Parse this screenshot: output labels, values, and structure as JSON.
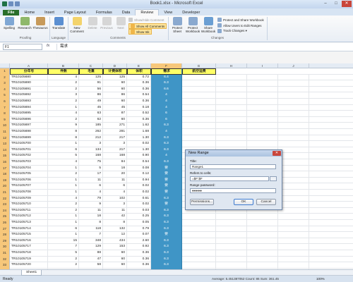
{
  "window": {
    "title": "Book1.xlsx - Microsoft Excel",
    "controls": [
      "–",
      "□",
      "✕"
    ]
  },
  "ribbon": {
    "tabs": [
      "File",
      "Home",
      "Insert",
      "Page Layout",
      "Formulas",
      "Data",
      "Review",
      "View",
      "Developer"
    ],
    "active_tab": "Review",
    "buttons": {
      "spelling": "Spelling",
      "research": "Research",
      "thesaurus": "Thesaurus",
      "translate": "Translate",
      "new_comment": "New Comment",
      "delete": "Delete",
      "previous": "Previous",
      "next": "Next",
      "show_hide_comment": "Show/Hide Comment",
      "show_all_comments": "Show All Comments",
      "show_ink": "Show Ink",
      "protect_sheet": "Protect Sheet",
      "protect_workbook": "Protect Workbook",
      "share_workbook": "Share Workbook",
      "protect_and_share": "Protect and Share Workbook",
      "allow_users": "Allow Users to Edit Ranges",
      "track_changes": "Track Changes ▾"
    },
    "groups": [
      "Proofing",
      "Language",
      "Comments",
      "Changes"
    ]
  },
  "formula_bar": {
    "name_box": "F1",
    "fx": "fx",
    "content": "需求"
  },
  "sheet": {
    "columns": [
      "A",
      "B",
      "C",
      "D",
      "E",
      "F",
      "G",
      "H",
      "I",
      "J"
    ],
    "selected_column": "F",
    "header_row": [
      "分年号",
      "件数",
      "毛重",
      "计费体积",
      "体积",
      "需求",
      "航空运费"
    ],
    "rows": [
      [
        "TR10105680",
        "4",
        "125",
        "125",
        "0.72",
        "6.4"
      ],
      [
        "TR10105690",
        "2",
        "91",
        "60",
        "0.36",
        "6.3"
      ],
      [
        "TR10105691",
        "2",
        "56",
        "60",
        "0.36",
        "6.6"
      ],
      [
        "TR10105692",
        "3",
        "86",
        "86",
        "0.54",
        "4"
      ],
      [
        "TR10105693",
        "2",
        "49",
        "60",
        "0.36",
        "4"
      ],
      [
        "TR10105694",
        "1",
        "45",
        "45",
        "0.18",
        "4"
      ],
      [
        "TR10105695",
        "4",
        "63",
        "87",
        "0.52",
        "6"
      ],
      [
        "TR10105696",
        "2",
        "62",
        "60",
        "0.36",
        "6"
      ],
      [
        "TR10105697",
        "9",
        "185",
        "271",
        "1.62",
        "6.3"
      ],
      [
        "TR10105698",
        "8",
        "262",
        "281",
        "1.68",
        "4"
      ],
      [
        "TR10105699",
        "8",
        "212",
        "217",
        "1.30",
        "6.3"
      ],
      [
        "TR10105700",
        "1",
        "3",
        "3",
        "0.02",
        "6.3"
      ],
      [
        "TR10105701",
        "6",
        "134",
        "217",
        "1.30",
        "6.3"
      ],
      [
        "TR10105702",
        "5",
        "168",
        "168",
        "0.90",
        "4"
      ],
      [
        "TR10105703",
        "4",
        "75",
        "84",
        "0.54",
        "6.3"
      ],
      [
        "TR10105704",
        "1",
        "5",
        "18",
        "0.08",
        "要"
      ],
      [
        "TR10105705",
        "2",
        "17",
        "20",
        "0.12",
        "要"
      ],
      [
        "TR10105706",
        "1",
        "11",
        "11",
        "0.94",
        "要"
      ],
      [
        "TR10105707",
        "1",
        "6",
        "6",
        "0.02",
        "要"
      ],
      [
        "TR10105708",
        "1",
        "4",
        "4",
        "0.02",
        "要"
      ],
      [
        "TR10105709",
        "4",
        "79",
        "102",
        "0.61",
        "6.3"
      ],
      [
        "TR10105710",
        "2",
        "9",
        "3",
        "0.02",
        "要"
      ],
      [
        "TR10105711",
        "2",
        "11",
        "11",
        "0.03",
        "6.3"
      ],
      [
        "TR10105712",
        "1",
        "18",
        "42",
        "0.25",
        "6.3"
      ],
      [
        "TR10105713",
        "1",
        "8",
        "8",
        "0.05",
        "6.3"
      ],
      [
        "TR10105714",
        "6",
        "118",
        "132",
        "0.79",
        "6.3"
      ],
      [
        "TR10105715",
        "1",
        "7",
        "12",
        "0.07",
        "要"
      ],
      [
        "TR10105716",
        "15",
        "348",
        "434",
        "2.60",
        "6.3"
      ],
      [
        "TR10105717",
        "7",
        "129",
        "153",
        "0.92",
        "6.3"
      ],
      [
        "TR10105718",
        "5",
        "88",
        "60",
        "0.36",
        "6.3"
      ],
      [
        "TR10105719",
        "2",
        "47",
        "60",
        "0.36",
        "6.3"
      ],
      [
        "TR10105720",
        "2",
        "58",
        "60",
        "0.36",
        "6.3"
      ],
      [
        "TR10105721",
        "1",
        "2",
        "2",
        "0.01",
        "6.3"
      ]
    ]
  },
  "sheet_tab": "Sheet1",
  "status": {
    "ready": "Ready",
    "stats": "Average: 5.451387052    Count: 86    Sum: 361.45",
    "zoom": "100%"
  },
  "dialog": {
    "title": "New Range",
    "close": "✕",
    "title_label": "Title:",
    "title_value": "Range1",
    "refers_label": "Refers to cells:",
    "refers_value": "=$F:$F",
    "password_label": "Range password:",
    "password_value": "●●●●●",
    "permissions_button": "Permissions...",
    "ok_button": "OK",
    "cancel_button": "Cancel"
  }
}
